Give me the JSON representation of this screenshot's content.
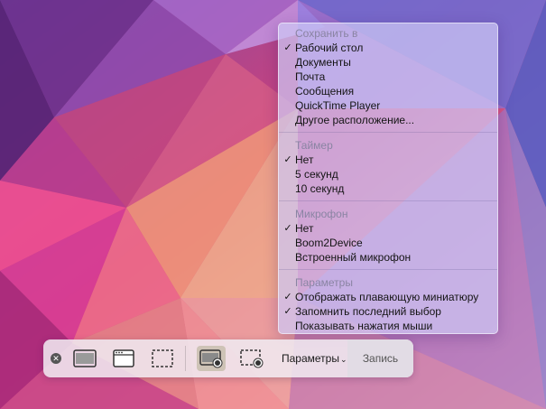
{
  "menu": {
    "save": {
      "header": "Сохранить в",
      "items": [
        {
          "label": "Рабочий стол",
          "checked": true
        },
        {
          "label": "Документы",
          "checked": false
        },
        {
          "label": "Почта",
          "checked": false
        },
        {
          "label": "Сообщения",
          "checked": false
        },
        {
          "label": "QuickTime Player",
          "checked": false
        },
        {
          "label": "Другое расположение...",
          "checked": false
        }
      ]
    },
    "timer": {
      "header": "Таймер",
      "items": [
        {
          "label": "Нет",
          "checked": true
        },
        {
          "label": "5 секунд",
          "checked": false
        },
        {
          "label": "10 секунд",
          "checked": false
        }
      ]
    },
    "mic": {
      "header": "Микрофон",
      "items": [
        {
          "label": "Нет",
          "checked": true
        },
        {
          "label": "Boom2Device",
          "checked": false
        },
        {
          "label": "Встроенный микрофон",
          "checked": false
        }
      ]
    },
    "params": {
      "header": "Параметры",
      "items": [
        {
          "label": "Отображать плавающую миниатюру",
          "checked": true
        },
        {
          "label": "Запомнить последний выбор",
          "checked": true
        },
        {
          "label": "Показывать нажатия мыши",
          "checked": false
        }
      ]
    },
    "check_glyph": "✓"
  },
  "toolbar": {
    "close_glyph": "✕",
    "options_label": "Параметры",
    "options_caret": "⌄",
    "record_label": "Запись",
    "buttons": [
      {
        "icon": "capture-entire-screen-icon",
        "selected": false
      },
      {
        "icon": "capture-selected-window-icon",
        "selected": false
      },
      {
        "icon": "capture-selected-portion-icon",
        "selected": false
      },
      {
        "icon": "record-entire-screen-icon",
        "selected": true
      },
      {
        "icon": "record-selected-portion-icon",
        "selected": false
      }
    ]
  },
  "colors": {
    "menu_bg": "#cdc8f5",
    "toolbar_bg": "#f0ebf2",
    "selected_button": "#c3b9a5"
  }
}
